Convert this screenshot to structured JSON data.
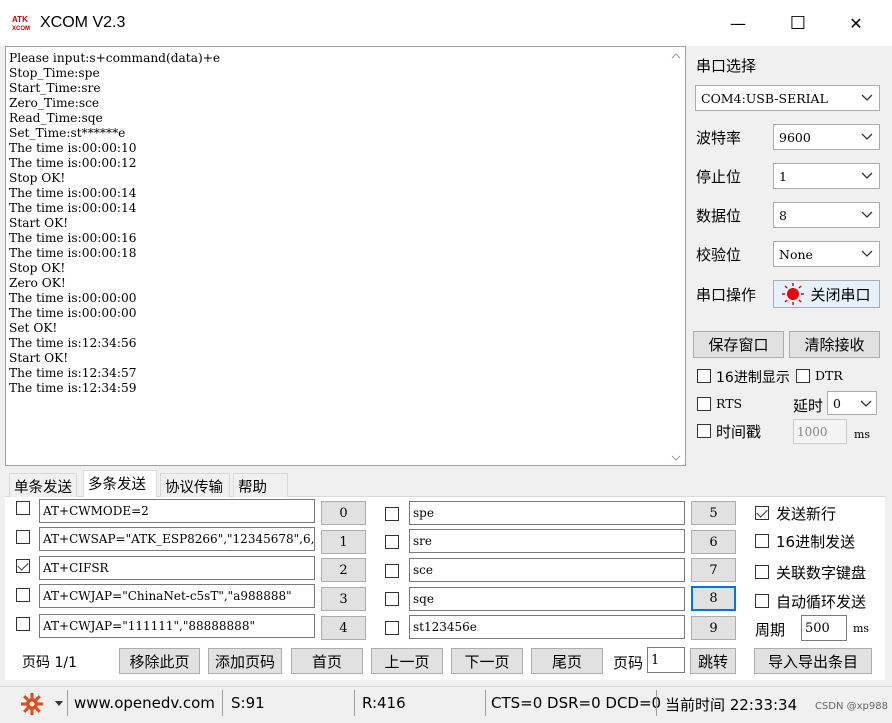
{
  "window": {
    "title": "XCOM V2.3",
    "icon_text_top": "ATK",
    "icon_text_bottom": "XCOM",
    "min_glyph": "—",
    "max_glyph": "☐",
    "close_glyph": "✕"
  },
  "receive": {
    "text": "Please input:s+command(data)+e\nStop_Time:spe\nStart_Time:sre\nZero_Time:sce\nRead_Time:sqe\nSet_Time:st******e\nThe time is:00:00:10\nThe time is:00:00:12\nStop OK!\nThe time is:00:00:14\nThe time is:00:00:14\nStart OK!\nThe time is:00:00:16\nThe time is:00:00:18\nStop OK!\nZero OK!\nThe time is:00:00:00\nThe time is:00:00:00\nSet OK!\nThe time is:12:34:56\nStart OK!\nThe time is:12:34:57\nThe time is:12:34:59"
  },
  "port": {
    "section_label": "串口选择",
    "port_value": "COM4:USB-SERIAL",
    "baud_label": "波特率",
    "baud_value": "9600",
    "stop_label": "停止位",
    "stop_value": "1",
    "data_label": "数据位",
    "data_value": "8",
    "parity_label": "校验位",
    "parity_value": "None",
    "op_label": "串口操作",
    "op_button": "关闭串口"
  },
  "receive_options": {
    "save_window": "保存窗口",
    "clear_receive": "清除接收",
    "hex_display": "16进制显示",
    "dtr": "DTR",
    "rts": "RTS",
    "delay_label": "延时",
    "delay_value": "0",
    "timestamp": "时间戳",
    "timestamp_value": "1000",
    "ms": "ms"
  },
  "tabs": [
    "单条发送",
    "多条发送",
    "协议传输",
    "帮助"
  ],
  "multi_send": {
    "left": [
      {
        "checked": false,
        "text": "AT+CWMODE=2",
        "button": "0"
      },
      {
        "checked": false,
        "text": "AT+CWSAP=\"ATK_ESP8266\",\"12345678\",6,",
        "button": "1"
      },
      {
        "checked": true,
        "text": "AT+CIFSR",
        "button": "2"
      },
      {
        "checked": false,
        "text": "AT+CWJAP=\"ChinaNet-c5sT\",\"a988888\"",
        "button": "3"
      },
      {
        "checked": false,
        "text": "AT+CWJAP=\"111111\",\"88888888\"",
        "button": "4"
      }
    ],
    "right": [
      {
        "checked": false,
        "text": "spe",
        "button": "5"
      },
      {
        "checked": false,
        "text": "sre",
        "button": "6"
      },
      {
        "checked": false,
        "text": "sce",
        "button": "7"
      },
      {
        "checked": false,
        "text": "sqe",
        "button": "8"
      },
      {
        "checked": false,
        "text": "st123456e",
        "button": "9"
      }
    ],
    "send_newline": "发送新行",
    "hex_send": "16进制发送",
    "numpad": "关联数字键盘",
    "auto_loop": "自动循环发送",
    "period_label": "周期",
    "period_value": "500",
    "period_unit": "ms"
  },
  "pager": {
    "page_label": "页码 1/1",
    "remove_page": "移除此页",
    "add_page": "添加页码",
    "first": "首页",
    "prev": "上一页",
    "next": "下一页",
    "last": "尾页",
    "goto_label": "页码",
    "goto_value": "1",
    "jump": "跳转",
    "import_export": "导入导出条目"
  },
  "status": {
    "url": "www.openedv.com",
    "sent": "S:91",
    "received": "R:416",
    "lines": "CTS=0 DSR=0 DCD=0",
    "time": "当前时间 22:33:34",
    "watermark": "CSDN @xp988"
  }
}
